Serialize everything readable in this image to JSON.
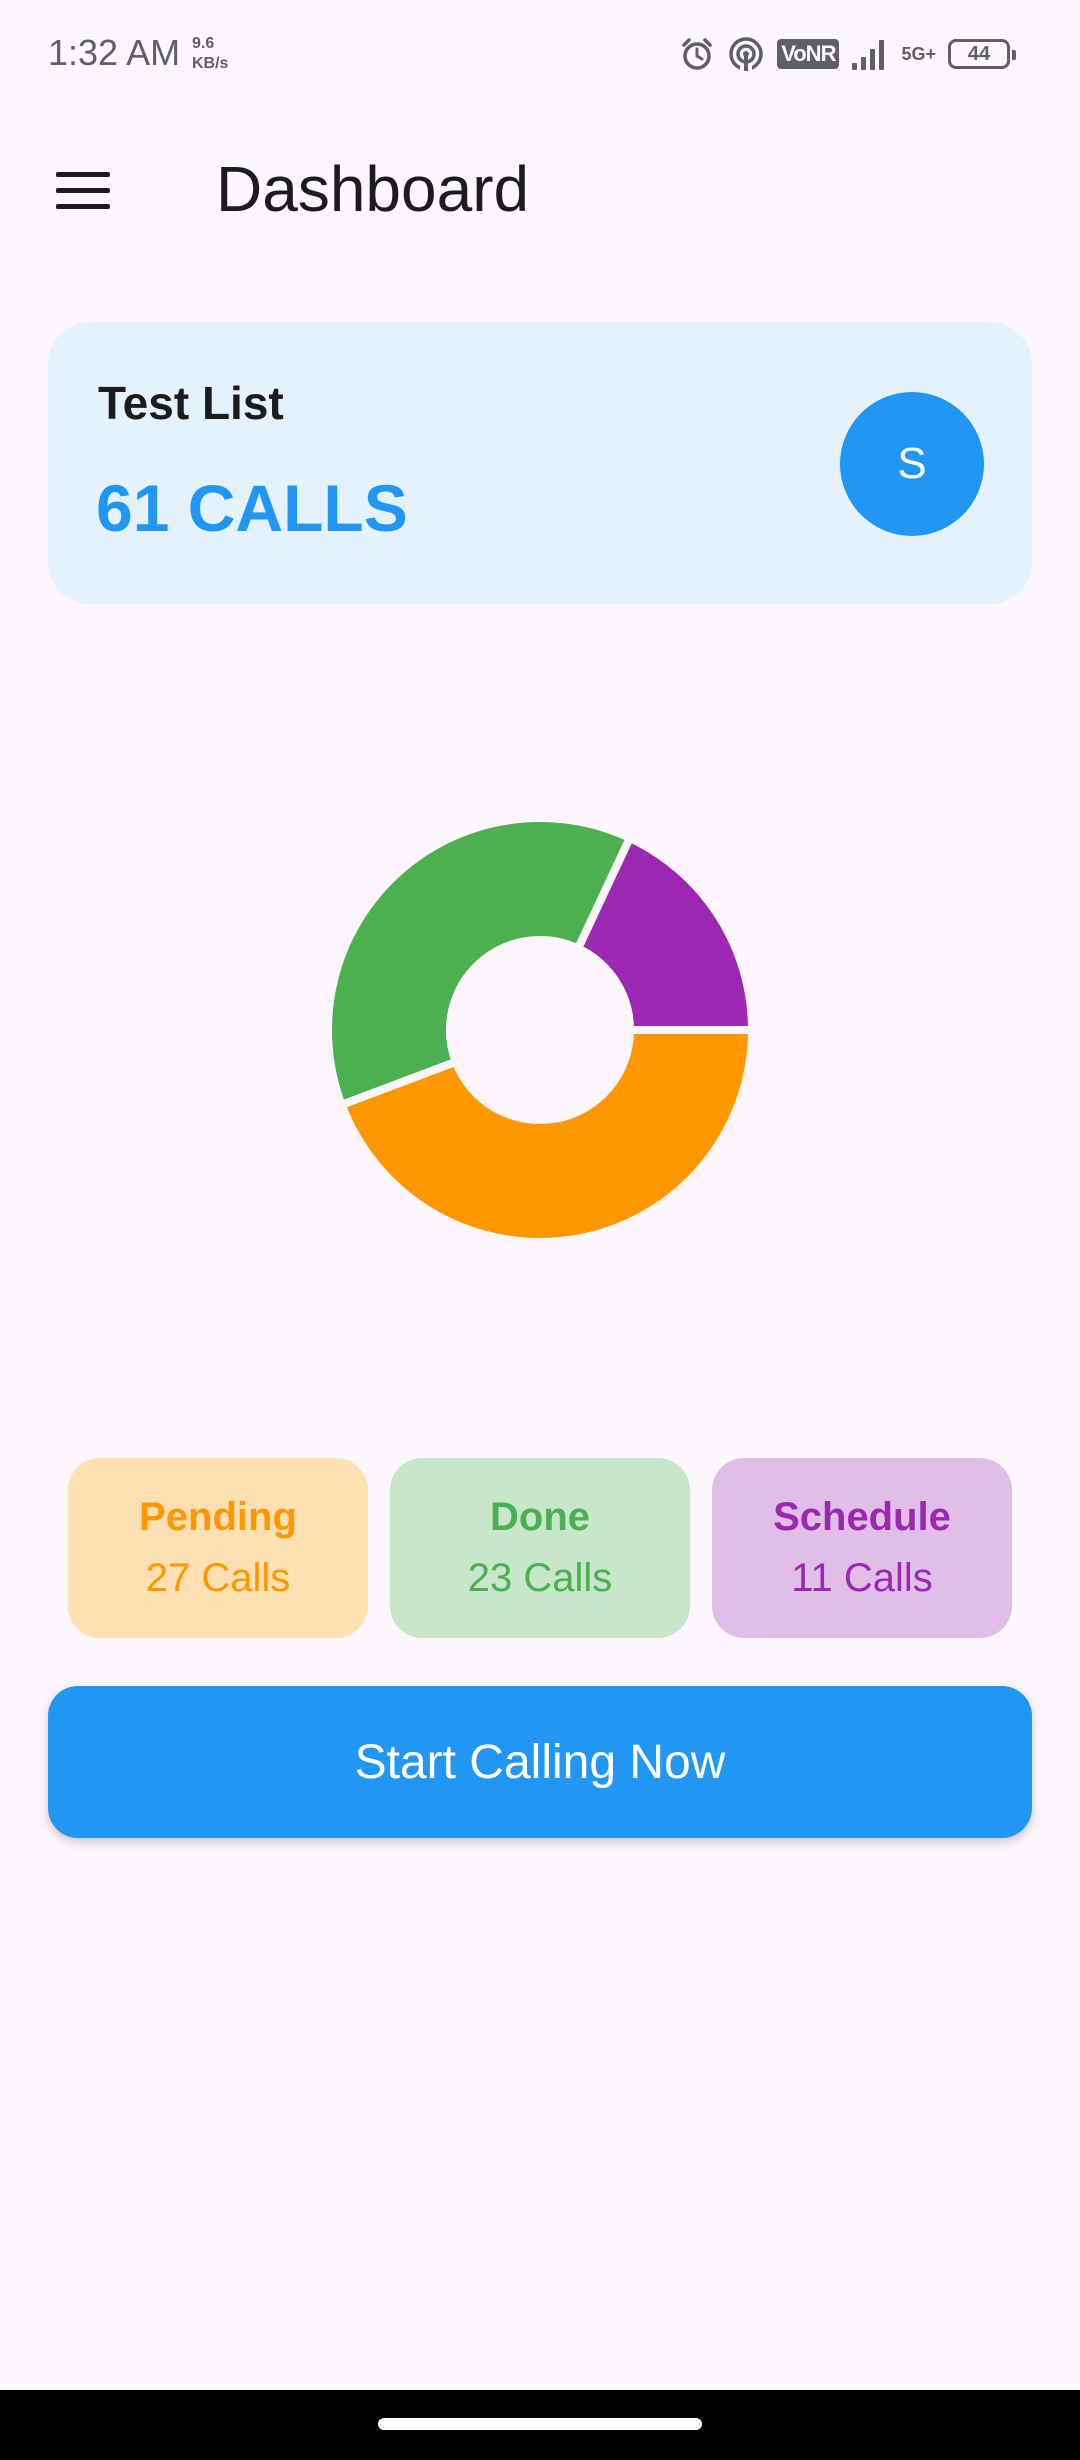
{
  "status_bar": {
    "time": "1:32 AM",
    "speed_value": "9.6",
    "speed_unit": "KB/s",
    "network_badge": "VoNR",
    "network_type": "5G+",
    "battery": "44"
  },
  "app_bar": {
    "title": "Dashboard"
  },
  "summary_card": {
    "list_name": "Test List",
    "total_calls": "61 CALLS",
    "avatar_letter": "S"
  },
  "chart_data": {
    "type": "pie",
    "categories": [
      "Pending",
      "Done",
      "Schedule"
    ],
    "values": [
      27,
      23,
      11
    ],
    "colors": [
      "#ff9800",
      "#4caf50",
      "#9c27b0"
    ],
    "donut": true
  },
  "stats": [
    {
      "label": "Pending",
      "value": "27 Calls"
    },
    {
      "label": "Done",
      "value": "23 Calls"
    },
    {
      "label": "Schedule",
      "value": "11 Calls"
    }
  ],
  "cta": {
    "label": "Start Calling Now"
  },
  "colors": {
    "background": "#fdf6fd",
    "primary": "#2196f3",
    "pending": "#ff9800",
    "done": "#4caf50",
    "schedule": "#9c27b0"
  },
  "icons": {
    "menu": "menu-icon",
    "alarm": "alarm-icon",
    "hotspot": "hotspot-icon",
    "signal": "signal-icon",
    "battery": "battery-icon"
  }
}
